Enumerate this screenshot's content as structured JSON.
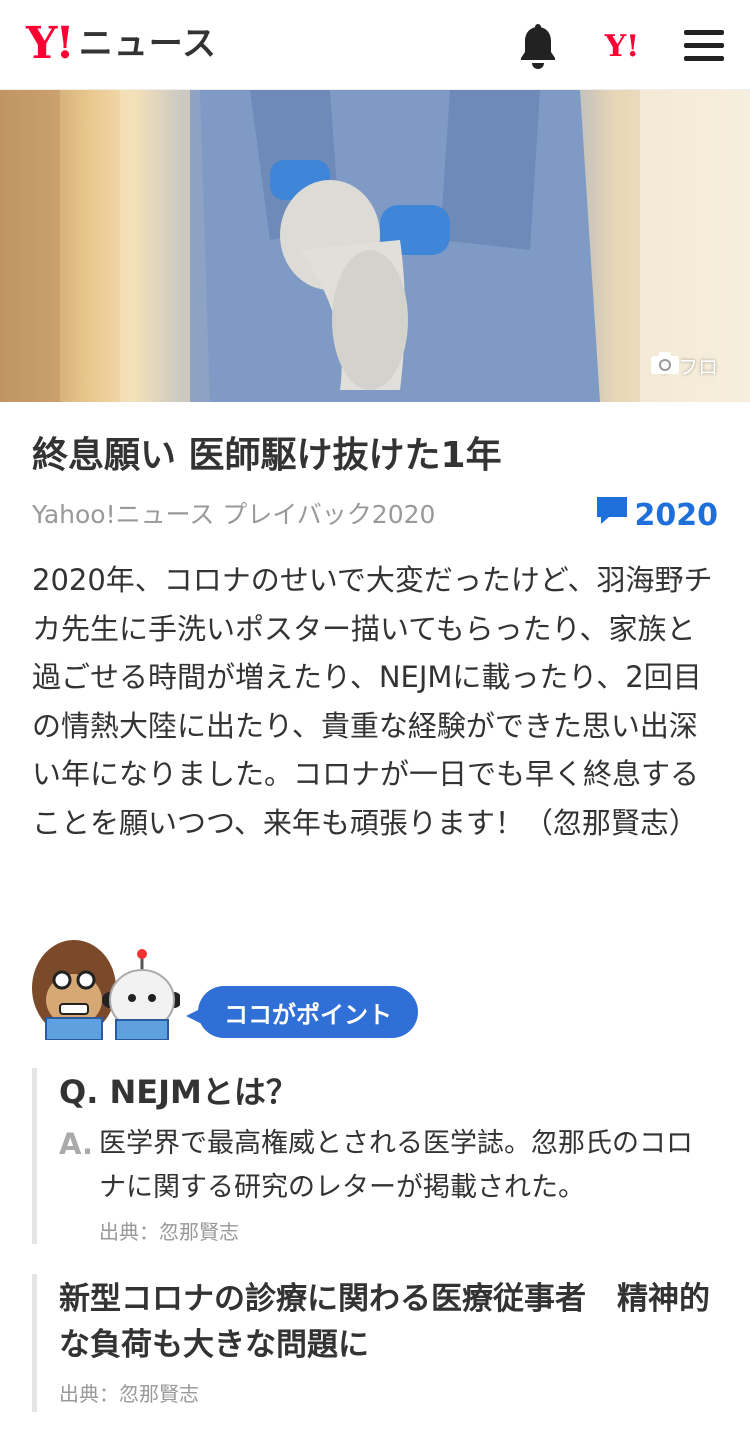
{
  "header": {
    "logo_mark": "Y!",
    "logo_text": "ニュース",
    "icons": [
      "bell-icon",
      "yahoo-icon",
      "menu-icon"
    ],
    "yahoo_mark": "Y!"
  },
  "hero": {
    "photo_credit": "アフロ",
    "credit_icon": "camera-icon"
  },
  "article": {
    "title": "終息願い 医師駆け抜けた1年",
    "source": "Yahoo!ニュース プレイバック2020",
    "comment_label": "2020",
    "comment_icon": "comment-icon",
    "body": "2020年、コロナのせいで大変だったけど、羽海野チカ先生に手洗いポスター描いてもらったり、家族と過ごせる時間が増えたり、NEJMに載ったり、2回目の情熱大陸に出たり、貴重な経験ができた思い出深い年になりました。コロナが一日でも早く終息することを願いつつ、来年も頑張ります！（忽那賢志）"
  },
  "point": {
    "badge_label": "ココがポイント",
    "qa": {
      "question": "Q. NEJMとは？",
      "answer_label": "A.",
      "answer": "医学界で最高権威とされる医学誌。忽那氏のコロナに関する研究のレターが掲載された。",
      "source": "出典：忽那賢志"
    },
    "note": {
      "title": "新型コロナの診療に関わる医療従事者　精神的な負荷も大きな問題に",
      "source": "出典：忽那賢志"
    }
  },
  "colors": {
    "brand_red": "#ff0033",
    "accent_blue": "#2f6fd6",
    "comment_blue": "#1e6fd9",
    "text_dark": "#333333",
    "text_muted": "#999999"
  }
}
